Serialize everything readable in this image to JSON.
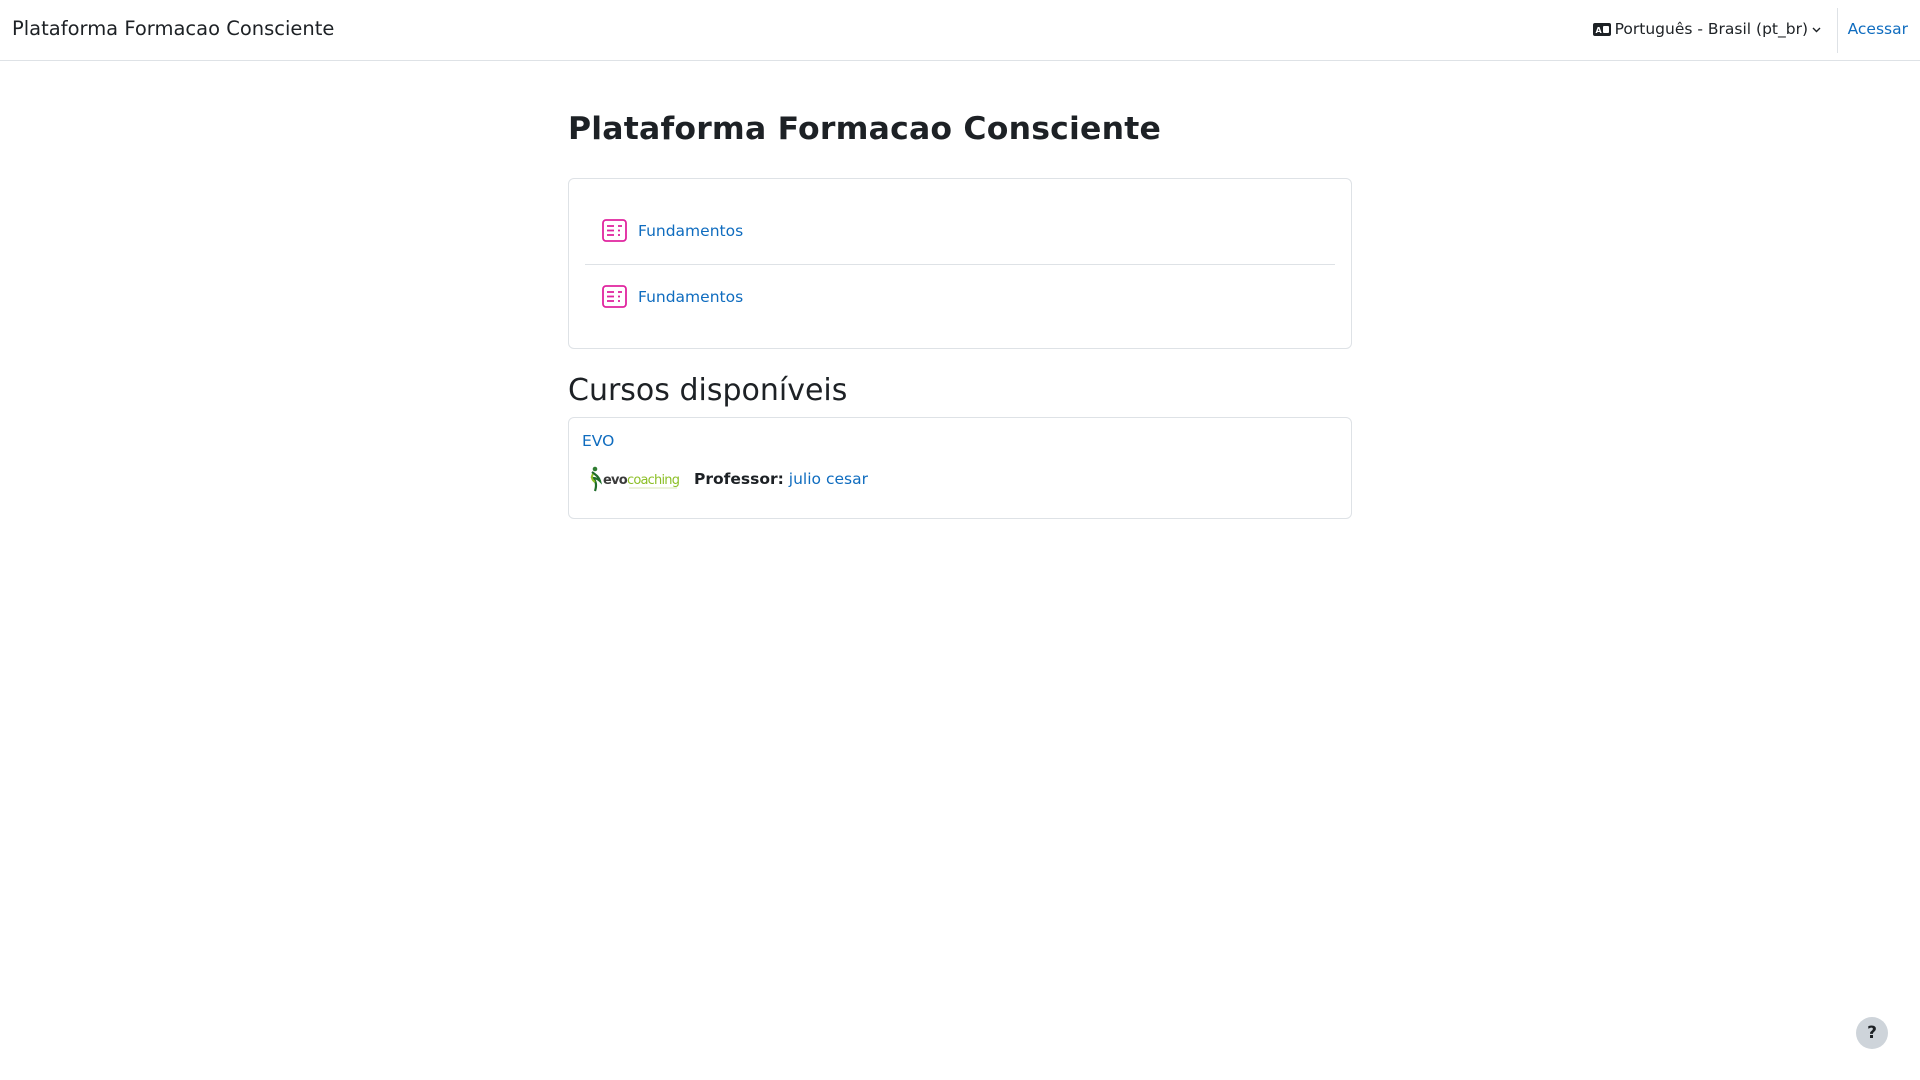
{
  "header": {
    "site_name": "Plataforma Formacao Consciente",
    "language_label": "Português - Brasil (pt_br)",
    "login_label": "Acessar"
  },
  "main": {
    "title": "Plataforma Formacao Consciente",
    "activities": [
      {
        "label": "Fundamentos",
        "icon": "page-icon"
      },
      {
        "label": "Fundamentos",
        "icon": "page-icon"
      }
    ],
    "courses_heading": "Cursos disponíveis",
    "course": {
      "name": "EVO",
      "image_alt": "evocoaching",
      "teacher_label": "Professor:",
      "teacher_name": "julio cesar"
    }
  },
  "help_button": "?",
  "colors": {
    "link": "#0f6cbf",
    "activity_icon": "#e0249f",
    "border": "#dee2e6"
  }
}
